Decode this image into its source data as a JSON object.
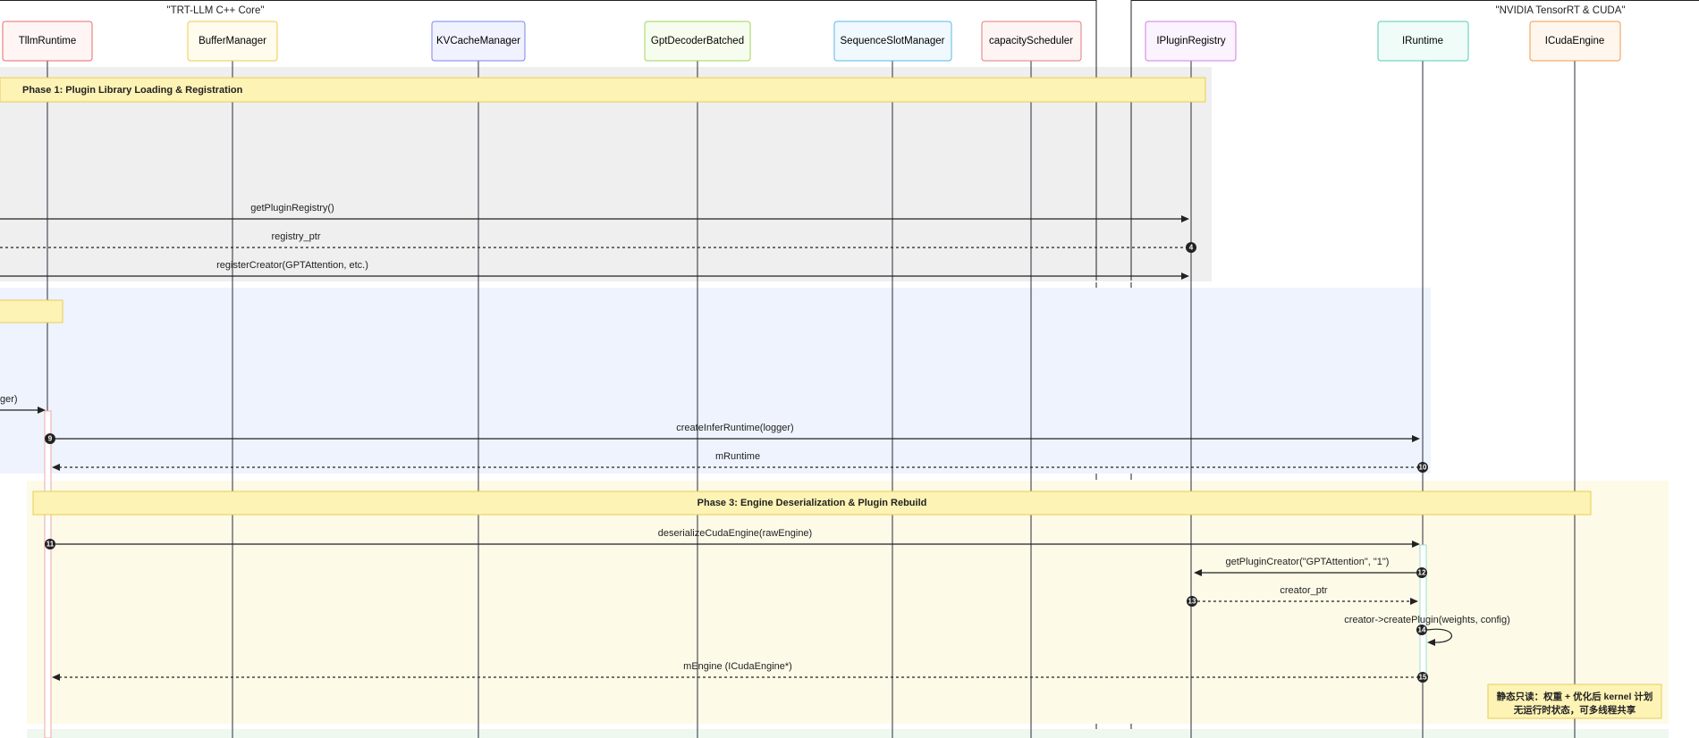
{
  "groups": {
    "core": "\"TRT-LLM C++ Core\"",
    "nvidia": "\"NVIDIA TensorRT & CUDA\""
  },
  "participants": [
    {
      "id": "tllm",
      "label": "TllmRuntime",
      "stroke": "#ea6b6b",
      "fill": "#fff5f5"
    },
    {
      "id": "buf",
      "label": "BufferManager",
      "stroke": "#f0c84a",
      "fill": "#fffcee"
    },
    {
      "id": "kv",
      "label": "KVCacheManager",
      "stroke": "#7b86e8",
      "fill": "#f1f2ff"
    },
    {
      "id": "gpt",
      "label": "GptDecoderBatched",
      "stroke": "#9fd45a",
      "fill": "#f7fdee"
    },
    {
      "id": "seq",
      "label": "SequenceSlotManager",
      "stroke": "#5ab8e6",
      "fill": "#f0f9ff"
    },
    {
      "id": "cap",
      "label": "capacityScheduler",
      "stroke": "#e57a7a",
      "fill": "#fff4f4"
    },
    {
      "id": "reg",
      "label": "IPluginRegistry",
      "stroke": "#d17ee6",
      "fill": "#fbf3ff"
    },
    {
      "id": "rt",
      "label": "IRuntime",
      "stroke": "#57cbb2",
      "fill": "#effcf8"
    },
    {
      "id": "eng",
      "label": "ICudaEngine",
      "stroke": "#f09a4c",
      "fill": "#fff6ee"
    }
  ],
  "phases": [
    {
      "label": "Phase 1: Plugin Library Loading & Registration"
    },
    {
      "label": ""
    },
    {
      "label": "Phase 3: Engine Deserialization & Plugin Rebuild"
    }
  ],
  "messages": [
    {
      "label": "getPluginRegistry()",
      "from": "left-edge",
      "to": "reg",
      "style": "solid",
      "num": ""
    },
    {
      "label": "registry_ptr",
      "from": "reg",
      "to": "left-edge",
      "style": "dashed",
      "num": "4"
    },
    {
      "label": "registerCreator(GPTAttention, etc.)",
      "from": "left-edge",
      "to": "reg",
      "style": "solid",
      "num": ""
    },
    {
      "label": "ger)",
      "from": "left-edge",
      "to": "tllm",
      "style": "solid",
      "num": ""
    },
    {
      "label": "createInferRuntime(logger)",
      "from": "tllm",
      "to": "rt",
      "style": "solid",
      "num": "9"
    },
    {
      "label": "mRuntime",
      "from": "rt",
      "to": "tllm",
      "style": "dashed",
      "num": "10"
    },
    {
      "label": "deserializeCudaEngine(rawEngine)",
      "from": "tllm",
      "to": "rt",
      "style": "solid",
      "num": "11"
    },
    {
      "label": "getPluginCreator(\"GPTAttention\", \"1\")",
      "from": "rt",
      "to": "reg",
      "style": "solid",
      "num": "12"
    },
    {
      "label": "creator_ptr",
      "from": "reg",
      "to": "rt",
      "style": "dashed",
      "num": "13"
    },
    {
      "label": "creator->createPlugin(weights, config)",
      "from": "rt",
      "to": "rt",
      "style": "self",
      "num": "14"
    },
    {
      "label": "mEngine (ICudaEngine*)",
      "from": "rt",
      "to": "tllm",
      "style": "dashed",
      "num": "15"
    }
  ],
  "note": {
    "line1": "静态只读：权重 + 优化后 kernel 计划",
    "line2": "无运行时状态，可多线程共享"
  },
  "colors": {
    "phase1_bg": "#efefef",
    "phase2_bg": "#eef3fd",
    "phase3_bg": "#fdfae8",
    "phase4_bg": "#eef8ef",
    "phase_bar": "#fdf3b5",
    "phase_bar_stroke": "#e8cd55",
    "lifeline": "#2b2b3a",
    "arrow": "#222222"
  }
}
